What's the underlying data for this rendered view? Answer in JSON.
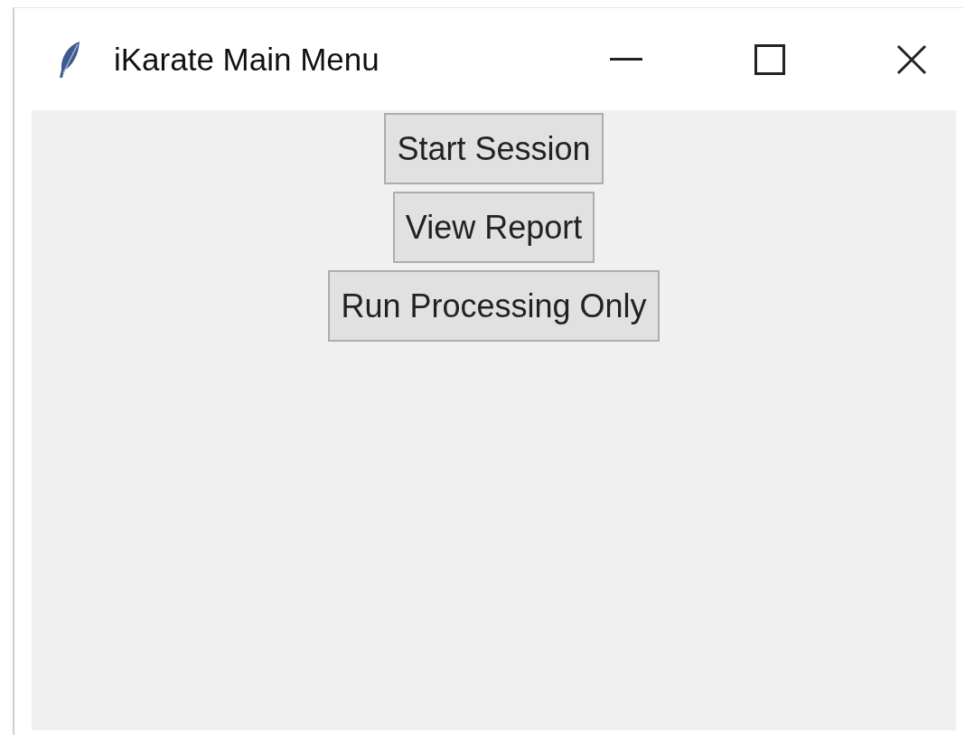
{
  "window": {
    "title": "iKarate Main Menu"
  },
  "buttons": [
    "Start Session",
    "View Report",
    "Run Processing Only"
  ]
}
